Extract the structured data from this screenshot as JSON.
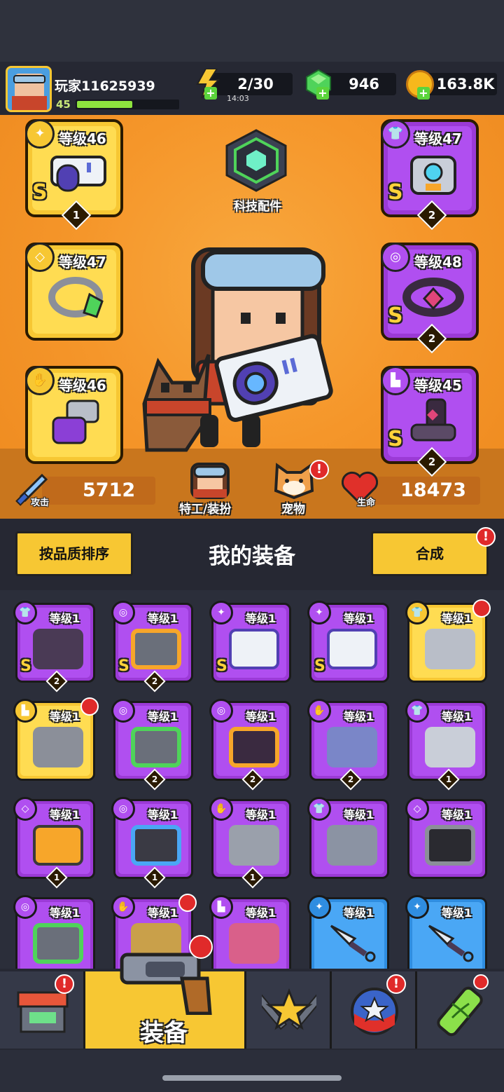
{
  "player": {
    "name": "玩家11625939",
    "level": "45",
    "xp_fraction": 0.55
  },
  "resources": {
    "energy": "2/30",
    "energy_timer": "14:03",
    "gems": "946",
    "coins": "163.8K"
  },
  "tech_parts_label": "科技配件",
  "equipped": {
    "weapon": {
      "level": "等级46",
      "grade": "S",
      "stars": "1"
    },
    "armor": {
      "level": "等级47",
      "grade": "S",
      "stars": "2"
    },
    "ring": {
      "level": "等级47"
    },
    "belt": {
      "level": "等级48",
      "grade": "S",
      "stars": "2"
    },
    "gloves": {
      "level": "等级46"
    },
    "boots": {
      "level": "等级45",
      "grade": "S",
      "stars": "2"
    }
  },
  "stats": {
    "attack_label": "攻击",
    "attack_value": "5712",
    "hp_label": "生命",
    "hp_value": "18473"
  },
  "middle_buttons": {
    "agent_label": "特工/装扮",
    "pet_label": "宠物",
    "pet_alert": "!"
  },
  "controls": {
    "sort_label": "按品质排序",
    "title": "我的装备",
    "merge_label": "合成",
    "merge_alert": "!"
  },
  "inventory": [
    {
      "level": "等级1",
      "grade": "S",
      "stars": "2"
    },
    {
      "level": "等级1",
      "grade": "S",
      "stars": "2"
    },
    {
      "level": "等级1",
      "grade": "S",
      "stars": ""
    },
    {
      "level": "等级1",
      "grade": "S",
      "stars": ""
    },
    {
      "level": "等级1",
      "grade": "",
      "stars": ""
    },
    {
      "level": "等级1",
      "grade": "",
      "stars": ""
    },
    {
      "level": "等级1",
      "grade": "",
      "stars": "2"
    },
    {
      "level": "等级1",
      "grade": "",
      "stars": "2"
    },
    {
      "level": "等级1",
      "grade": "",
      "stars": "2"
    },
    {
      "level": "等级1",
      "grade": "",
      "stars": "1"
    },
    {
      "level": "等级1",
      "grade": "",
      "stars": "1"
    },
    {
      "level": "等级1",
      "grade": "",
      "stars": "1"
    },
    {
      "level": "等级1",
      "grade": "",
      "stars": "1"
    },
    {
      "level": "等级1",
      "grade": "",
      "stars": ""
    },
    {
      "level": "等级1",
      "grade": "",
      "stars": ""
    },
    {
      "level": "等级1",
      "grade": "",
      "stars": ""
    },
    {
      "level": "等级1",
      "grade": "",
      "stars": ""
    },
    {
      "level": "等级1",
      "grade": "",
      "stars": ""
    },
    {
      "level": "等级1",
      "grade": "",
      "stars": ""
    },
    {
      "level": "等级1",
      "grade": "",
      "stars": ""
    }
  ],
  "nav": {
    "equipment_label": "装备",
    "alert": "!"
  },
  "colors": {
    "gold": "#f7c733",
    "purple": "#b04ff0",
    "blue": "#4aa7f5",
    "orange_bg": "#f5962a",
    "alert_red": "#e02a2a"
  }
}
